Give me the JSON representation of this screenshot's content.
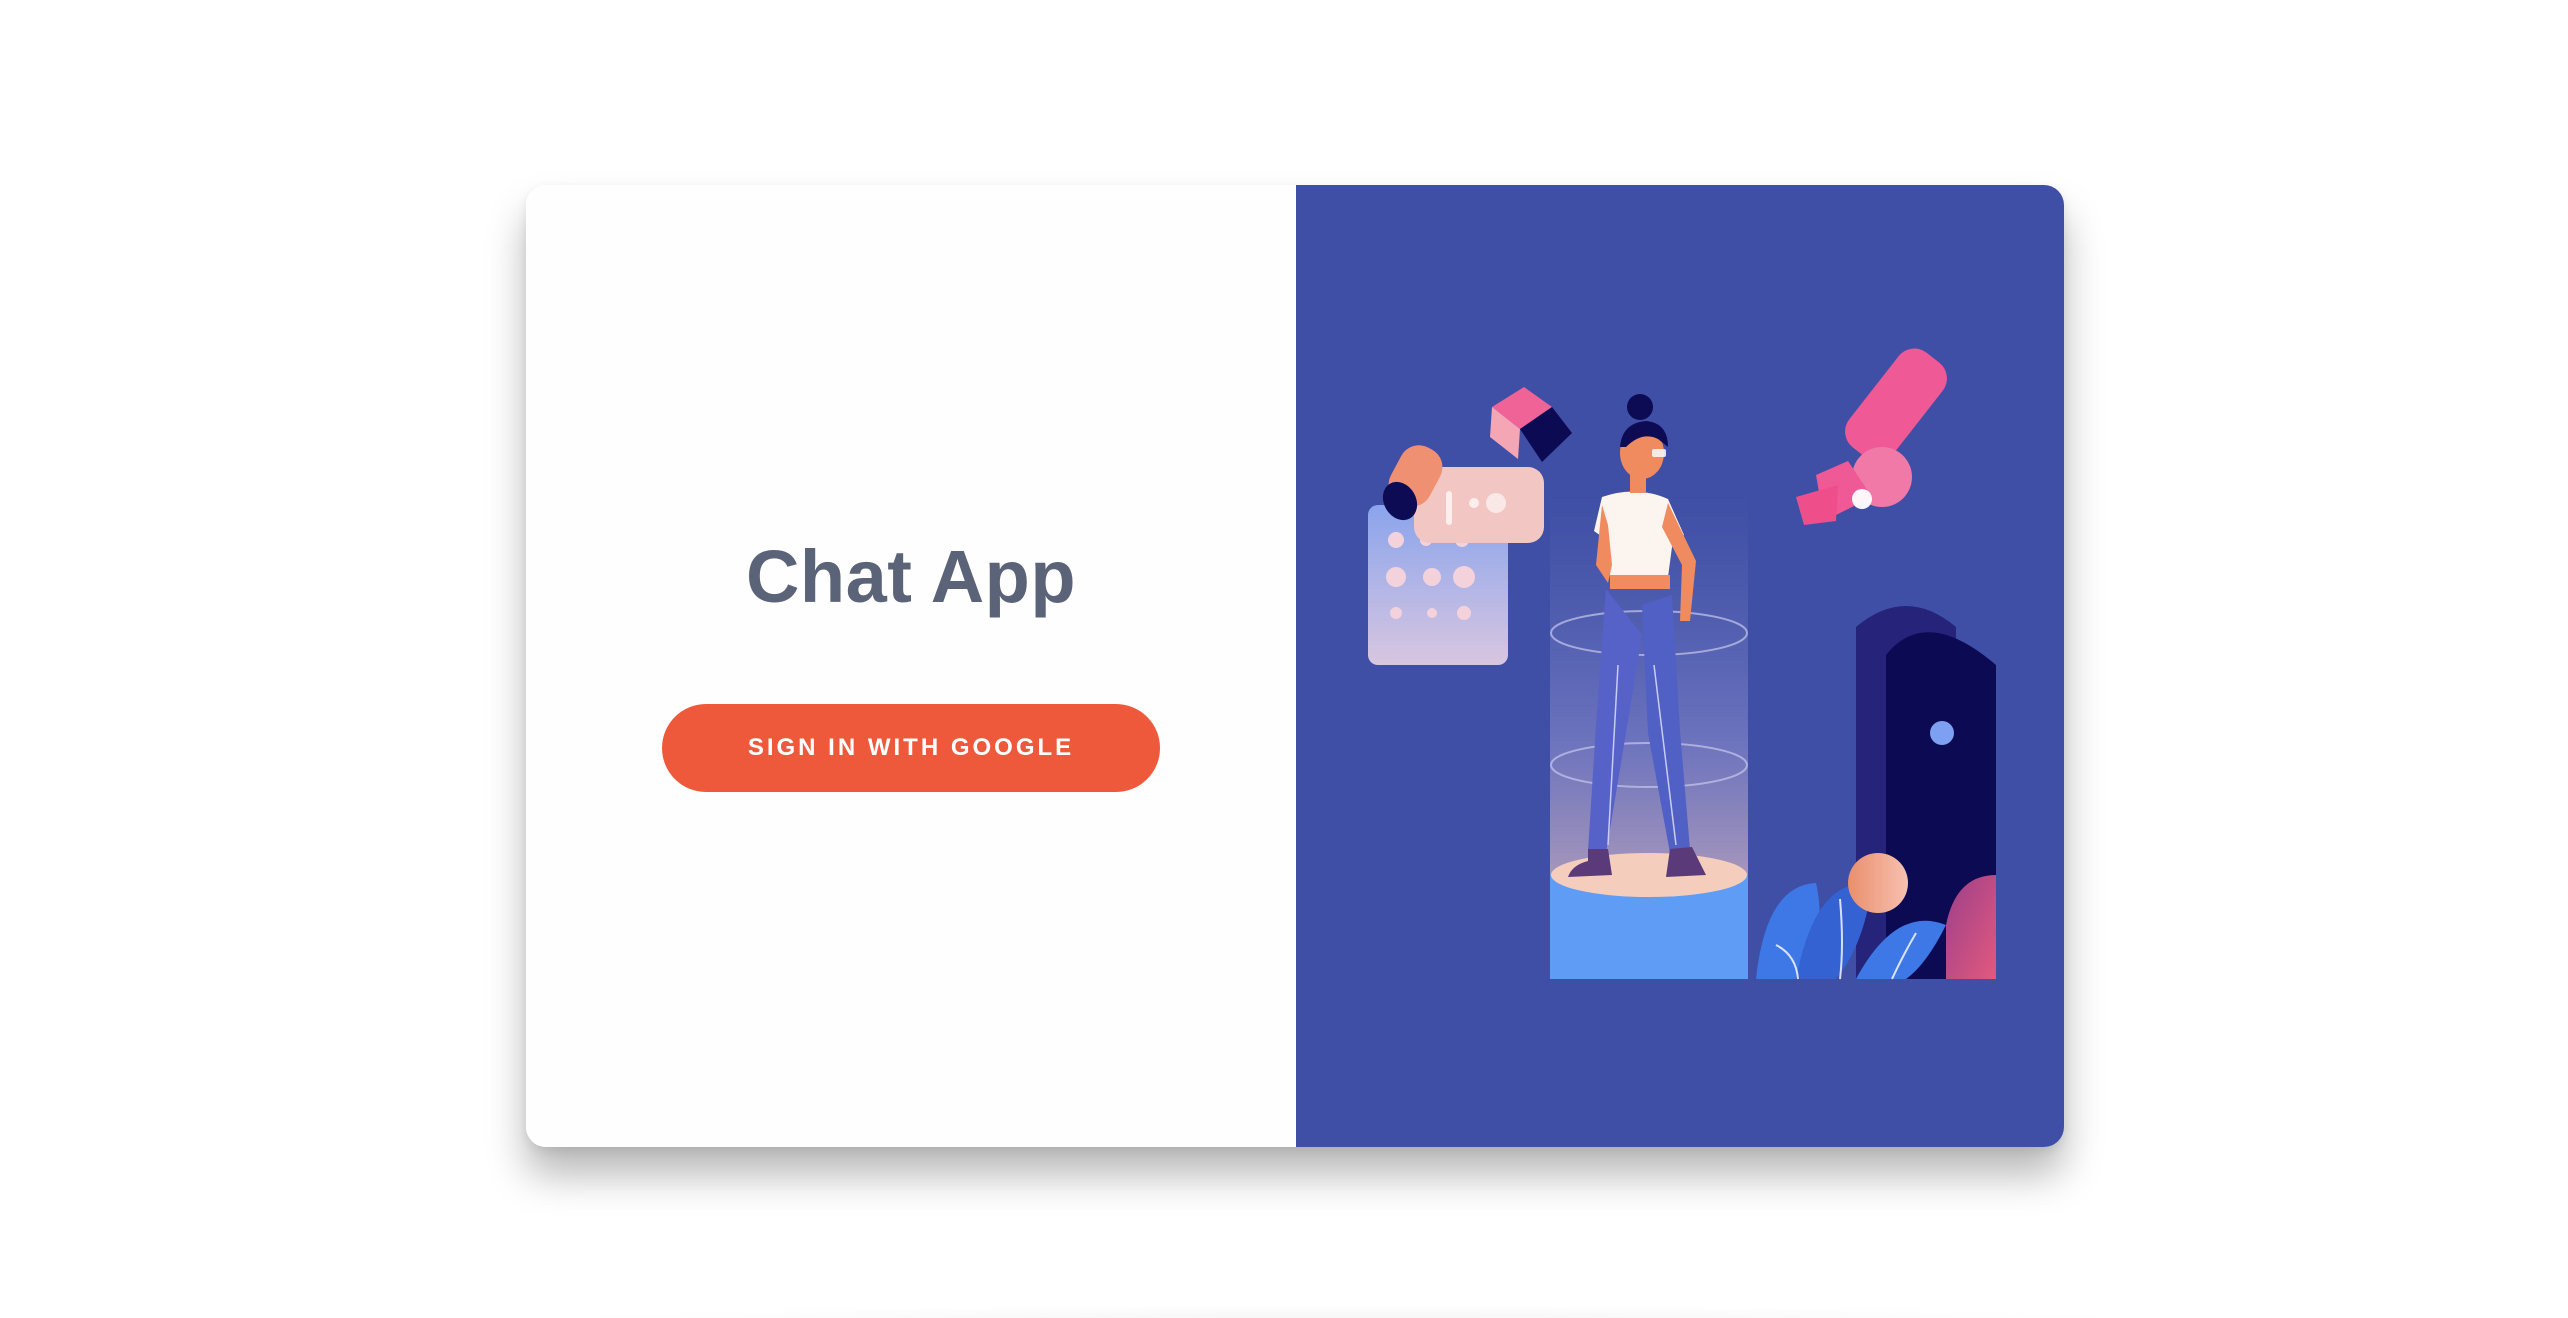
{
  "app": {
    "title": "Chat App"
  },
  "auth": {
    "google_button_label": "SIGN IN WITH GOOGLE"
  },
  "colors": {
    "panel_left": "#fefefe",
    "panel_right": "#3f4fa5",
    "button": "#ee593b",
    "title_text": "#5b6378",
    "button_text": "#ffffff"
  },
  "illustration": {
    "icon": "woman-in-virtual-space-illustration"
  }
}
